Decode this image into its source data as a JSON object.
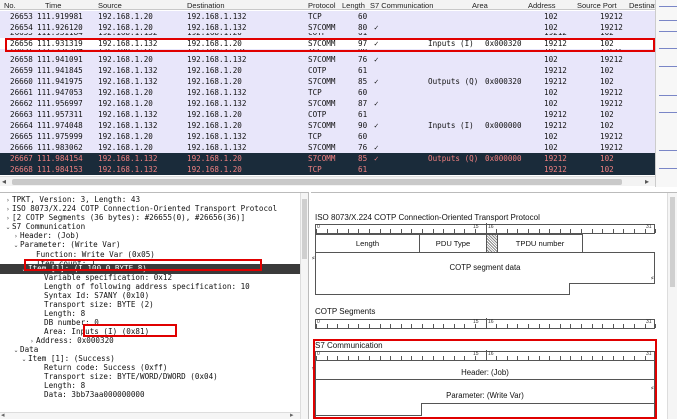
{
  "packet_list": {
    "columns": [
      "No.",
      "Time",
      "Source",
      "Destination",
      "Protocol",
      "Length",
      "S7 Communication",
      "Area",
      "Address",
      "Source Port",
      "Destination"
    ],
    "rows": [
      {
        "no": "26653",
        "time": "111.919981",
        "src": "192.168.1.20",
        "dst": "192.168.1.132",
        "proto": "TCP",
        "len": "60",
        "s7": "",
        "area": "",
        "addr": "",
        "sport": "102",
        "dport": "19212"
      },
      {
        "no": "26654",
        "time": "111.926120",
        "src": "192.168.1.20",
        "dst": "192.168.1.132",
        "proto": "S7COMM",
        "len": "80",
        "s7": "✓",
        "area": "",
        "addr": "",
        "sport": "102",
        "dport": "19212"
      },
      {
        "no": "26655",
        "time": "111.931184",
        "src": "192.168.1.132",
        "dst": "192.168.1.20",
        "proto": "COTP",
        "len": "61",
        "s7": "",
        "area": "",
        "addr": "",
        "sport": "19212",
        "dport": "102"
      },
      {
        "no": "26656",
        "time": "111.931319",
        "src": "192.168.1.132",
        "dst": "192.168.1.20",
        "proto": "S7COMM",
        "len": "97",
        "s7": "✓",
        "area": "Inputs (I)",
        "addr": "0x000320",
        "sport": "19212",
        "dport": "102"
      },
      {
        "no": "26657",
        "time": "111.932984",
        "src": "192.168.1.20",
        "dst": "192.168.1.132",
        "proto": "TCP",
        "len": "60",
        "s7": "",
        "area": "",
        "addr": "",
        "sport": "102",
        "dport": "19212"
      },
      {
        "no": "26658",
        "time": "111.941091",
        "src": "192.168.1.20",
        "dst": "192.168.1.132",
        "proto": "S7COMM",
        "len": "76",
        "s7": "✓",
        "area": "",
        "addr": "",
        "sport": "102",
        "dport": "19212"
      },
      {
        "no": "26659",
        "time": "111.941845",
        "src": "192.168.1.132",
        "dst": "192.168.1.20",
        "proto": "COTP",
        "len": "61",
        "s7": "",
        "area": "",
        "addr": "",
        "sport": "19212",
        "dport": "102"
      },
      {
        "no": "26660",
        "time": "111.941975",
        "src": "192.168.1.132",
        "dst": "192.168.1.20",
        "proto": "S7COMM",
        "len": "85",
        "s7": "✓",
        "area": "Outputs (Q)",
        "addr": "0x000320",
        "sport": "19212",
        "dport": "102"
      },
      {
        "no": "26661",
        "time": "111.947053",
        "src": "192.168.1.20",
        "dst": "192.168.1.132",
        "proto": "TCP",
        "len": "60",
        "s7": "",
        "area": "",
        "addr": "",
        "sport": "102",
        "dport": "19212"
      },
      {
        "no": "26662",
        "time": "111.956997",
        "src": "192.168.1.20",
        "dst": "192.168.1.132",
        "proto": "S7COMM",
        "len": "87",
        "s7": "✓",
        "area": "",
        "addr": "",
        "sport": "102",
        "dport": "19212"
      },
      {
        "no": "26663",
        "time": "111.957311",
        "src": "192.168.1.132",
        "dst": "192.168.1.20",
        "proto": "COTP",
        "len": "61",
        "s7": "",
        "area": "",
        "addr": "",
        "sport": "19212",
        "dport": "102"
      },
      {
        "no": "26664",
        "time": "111.974048",
        "src": "192.168.1.132",
        "dst": "192.168.1.20",
        "proto": "S7COMM",
        "len": "90",
        "s7": "✓",
        "area": "Inputs (I)",
        "addr": "0x000000",
        "sport": "19212",
        "dport": "102"
      },
      {
        "no": "26665",
        "time": "111.975999",
        "src": "192.168.1.20",
        "dst": "192.168.1.132",
        "proto": "TCP",
        "len": "60",
        "s7": "",
        "area": "",
        "addr": "",
        "sport": "102",
        "dport": "19212"
      },
      {
        "no": "26666",
        "time": "111.983062",
        "src": "192.168.1.20",
        "dst": "192.168.1.132",
        "proto": "S7COMM",
        "len": "76",
        "s7": "✓",
        "area": "",
        "addr": "",
        "sport": "102",
        "dport": "19212"
      },
      {
        "no": "26667",
        "time": "111.984154",
        "src": "192.168.1.132",
        "dst": "192.168.1.20",
        "proto": "S7COMM",
        "len": "85",
        "s7": "✓",
        "area": "Outputs (Q)",
        "addr": "0x000000",
        "sport": "19212",
        "dport": "102"
      },
      {
        "no": "26668",
        "time": "111.984153",
        "src": "192.168.1.132",
        "dst": "192.168.1.20",
        "proto": "TCP",
        "len": "61",
        "s7": "",
        "area": "",
        "addr": "",
        "sport": "19212",
        "dport": "102"
      }
    ]
  },
  "details": {
    "lines": [
      {
        "arrow": "›",
        "text": "TPKT, Version: 3, Length: 43"
      },
      {
        "arrow": "›",
        "text": "ISO 8073/X.224 COTP Connection-Oriented Transport Protocol"
      },
      {
        "arrow": "›",
        "text": "[2 COTP Segments (36 bytes): #26655(0), #26656(36)]"
      },
      {
        "arrow": "⌄",
        "text": "S7 Communication"
      },
      {
        "arrow": "›",
        "text": "Header: (Job)"
      },
      {
        "arrow": "⌄",
        "text": "Parameter: (Write Var)"
      },
      {
        "arrow": "",
        "text": "Function: Write Var (0x05)"
      },
      {
        "arrow": "",
        "text": "Item count: 1"
      },
      {
        "arrow": "⌄",
        "text": "Item [1]: (I 100.0 BYTE 8)"
      },
      {
        "arrow": "",
        "text": "Variable specification: 0x12"
      },
      {
        "arrow": "",
        "text": "Length of following address specification: 10"
      },
      {
        "arrow": "",
        "text": "Syntax Id: S7ANY (0x10)"
      },
      {
        "arrow": "",
        "text": "Transport size: BYTE (2)"
      },
      {
        "arrow": "",
        "text": "Length: 8"
      },
      {
        "arrow": "",
        "text": "DB number: 0"
      },
      {
        "arrow": "",
        "text": "Area: Inputs (I) (0x81)"
      },
      {
        "arrow": "›",
        "text": "Address: 0x000320"
      },
      {
        "arrow": "⌄",
        "text": "Data"
      },
      {
        "arrow": "⌄",
        "text": "Item [1]: (Success)"
      },
      {
        "arrow": "",
        "text": "Return code: Success (0xff)"
      },
      {
        "arrow": "",
        "text": "Transport size: BYTE/WORD/DWORD (0x04)"
      },
      {
        "arrow": "",
        "text": "Length: 8"
      },
      {
        "arrow": "",
        "text": "Data: 3bb73aa000000000"
      }
    ]
  },
  "structure": {
    "cotp_title": "ISO 8073/X.224 COTP Connection-Oriented Transport Protocol",
    "fields": {
      "length": "Length",
      "pdu_type": "PDU Type",
      "tpdu": "TPDU number"
    },
    "cotp_data": "COTP segment data",
    "segments_title": "COTP Segments",
    "s7_title": "S7 Communication",
    "s7_header": "Header: (Job)",
    "s7_param": "Parameter: (Write Var)",
    "ruler_labels": {
      "start": "0",
      "mid_a": "15",
      "mid_b": "16",
      "end": "31"
    }
  },
  "colors": {
    "highlight_red": "#e00000",
    "row_bg": "#e8e6fa",
    "dark_row": "#1a2b3a"
  }
}
